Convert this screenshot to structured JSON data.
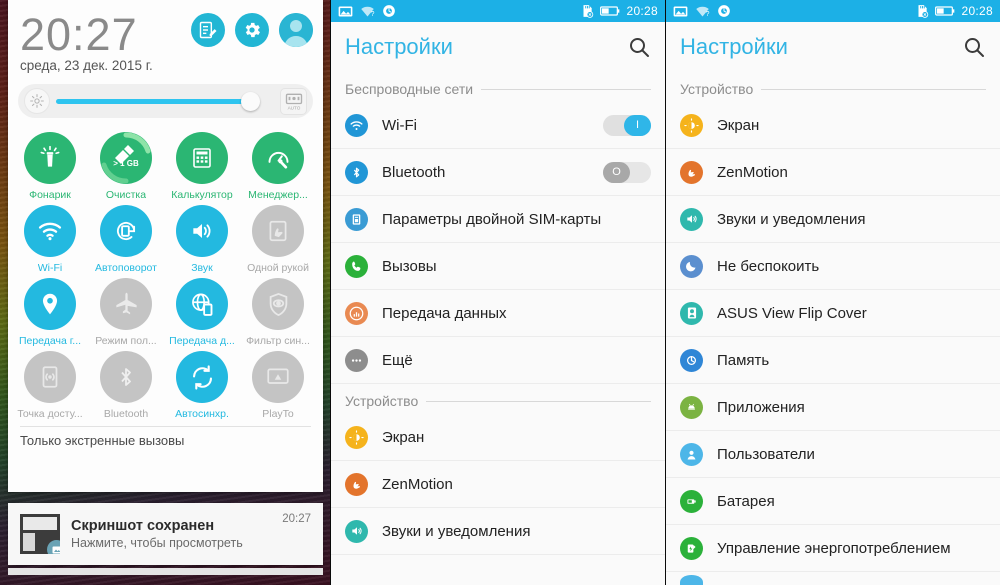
{
  "panel1": {
    "clock": "20:27",
    "date": "среда, 23 дек. 2015 г.",
    "header_icons": [
      {
        "name": "quick-note-icon",
        "label": "Быстрая заметка"
      },
      {
        "name": "settings-gear-icon",
        "label": "Настройки"
      },
      {
        "name": "user-avatar-icon",
        "label": "Профиль"
      }
    ],
    "brightness": {
      "left_icon": "brightness-icon",
      "right_icon": "auto-brightness-icon",
      "auto_label": "AUTO",
      "value_percent": 88
    },
    "tiles": [
      [
        {
          "label": "Фонарик",
          "icon": "flashlight-icon",
          "state": "on",
          "color": "#2bb673"
        },
        {
          "label": "Очистка",
          "icon": "broom-icon",
          "state": "on",
          "color": "#2bb673",
          "badge": "> 1 GB"
        },
        {
          "label": "Калькулятор",
          "icon": "calculator-icon",
          "state": "on",
          "color": "#2bb673"
        },
        {
          "label": "Менеджер...",
          "icon": "manager-icon",
          "state": "on",
          "color": "#2bb673"
        }
      ],
      [
        {
          "label": "Wi-Fi",
          "icon": "wifi-icon",
          "state": "on",
          "color": "#23b9e0"
        },
        {
          "label": "Автоповорот",
          "icon": "autorotate-icon",
          "state": "on",
          "color": "#23b9e0"
        },
        {
          "label": "Звук",
          "icon": "sound-icon",
          "state": "on",
          "color": "#23b9e0"
        },
        {
          "label": "Одной рукой",
          "icon": "one-hand-icon",
          "state": "off",
          "color": "#c4c4c4"
        }
      ],
      [
        {
          "label": "Передача г...",
          "icon": "location-icon",
          "state": "on",
          "color": "#23b9e0"
        },
        {
          "label": "Режим пол...",
          "icon": "airplane-icon",
          "state": "off",
          "color": "#c4c4c4"
        },
        {
          "label": "Передача д...",
          "icon": "mobile-data-icon",
          "state": "on",
          "color": "#23b9e0"
        },
        {
          "label": "Фильтр син...",
          "icon": "bluelight-filter-icon",
          "state": "off",
          "color": "#c4c4c4"
        }
      ],
      [
        {
          "label": "Точка досту...",
          "icon": "hotspot-icon",
          "state": "off",
          "color": "#c4c4c4"
        },
        {
          "label": "Bluetooth",
          "icon": "bluetooth-icon",
          "state": "off",
          "color": "#c4c4c4"
        },
        {
          "label": "Автосинхр.",
          "icon": "autosync-icon",
          "state": "on",
          "color": "#23b9e0"
        },
        {
          "label": "PlayTo",
          "icon": "playto-icon",
          "state": "off",
          "color": "#c4c4c4"
        }
      ]
    ],
    "emergency_text": "Только экстренные вызовы",
    "notification": {
      "title": "Скриншот сохранен",
      "subtitle": "Нажмите, чтобы просмотреть",
      "time": "20:27",
      "thumb_icon": "screenshot-thumbnail",
      "badge_icon": "image-icon"
    }
  },
  "panel2": {
    "statusbar": {
      "time": "20:28",
      "left_icons": [
        "gallery-icon",
        "wifi-question-icon",
        "moment-icon"
      ],
      "right_icons": [
        "sd-card-error-icon",
        "battery-icon"
      ]
    },
    "title": "Настройки",
    "search_icon": "search-icon",
    "sections": [
      {
        "label": "Беспроводные сети",
        "rows": [
          {
            "label": "Wi-Fi",
            "icon": "wifi-icon",
            "color": "#2196d6",
            "toggle": "on",
            "toggle_on_text": "I"
          },
          {
            "label": "Bluetooth",
            "icon": "bluetooth-icon",
            "color": "#2196d6",
            "toggle": "off",
            "toggle_off_text": "O"
          },
          {
            "label": "Параметры двойной SIM-карты",
            "icon": "dual-sim-icon",
            "color": "#3a9bd4"
          },
          {
            "label": "Вызовы",
            "icon": "phone-icon",
            "color": "#2bb13a"
          },
          {
            "label": "Передача данных",
            "icon": "data-usage-icon",
            "color": "#e98a52"
          },
          {
            "label": "Ещё",
            "icon": "more-icon",
            "color": "#8d8d8d"
          }
        ]
      },
      {
        "label": "Устройство",
        "rows": [
          {
            "label": "Экран",
            "icon": "display-icon",
            "color": "#f5b31c"
          },
          {
            "label": "ZenMotion",
            "icon": "zenmotion-icon",
            "color": "#e3742c"
          },
          {
            "label": "Звуки и уведомления",
            "icon": "sound-icon",
            "color": "#2fb8ad"
          }
        ]
      }
    ]
  },
  "panel3": {
    "statusbar": {
      "time": "20:28",
      "left_icons": [
        "gallery-icon",
        "wifi-question-icon",
        "moment-icon"
      ],
      "right_icons": [
        "sd-card-error-icon",
        "battery-icon"
      ]
    },
    "title": "Настройки",
    "search_icon": "search-icon",
    "sections": [
      {
        "label": "Устройство",
        "rows": [
          {
            "label": "Экран",
            "icon": "display-icon",
            "color": "#f5b31c"
          },
          {
            "label": "ZenMotion",
            "icon": "zenmotion-icon",
            "color": "#e3742c"
          },
          {
            "label": "Звуки и уведомления",
            "icon": "sound-icon",
            "color": "#2fb8ad"
          },
          {
            "label": "Не беспокоить",
            "icon": "do-not-disturb-icon",
            "color": "#5b8fcf"
          },
          {
            "label": "ASUS View Flip Cover",
            "icon": "flip-cover-icon",
            "color": "#2fb8ad"
          },
          {
            "label": "Память",
            "icon": "storage-icon",
            "color": "#2f86d6"
          },
          {
            "label": "Приложения",
            "icon": "apps-icon",
            "color": "#7bb342"
          },
          {
            "label": "Пользователи",
            "icon": "users-icon",
            "color": "#4db6e8"
          },
          {
            "label": "Батарея",
            "icon": "battery-icon",
            "color": "#2bb13a"
          },
          {
            "label": "Управление энергопотреблением",
            "icon": "power-management-icon",
            "color": "#2bb13a"
          }
        ]
      }
    ]
  }
}
